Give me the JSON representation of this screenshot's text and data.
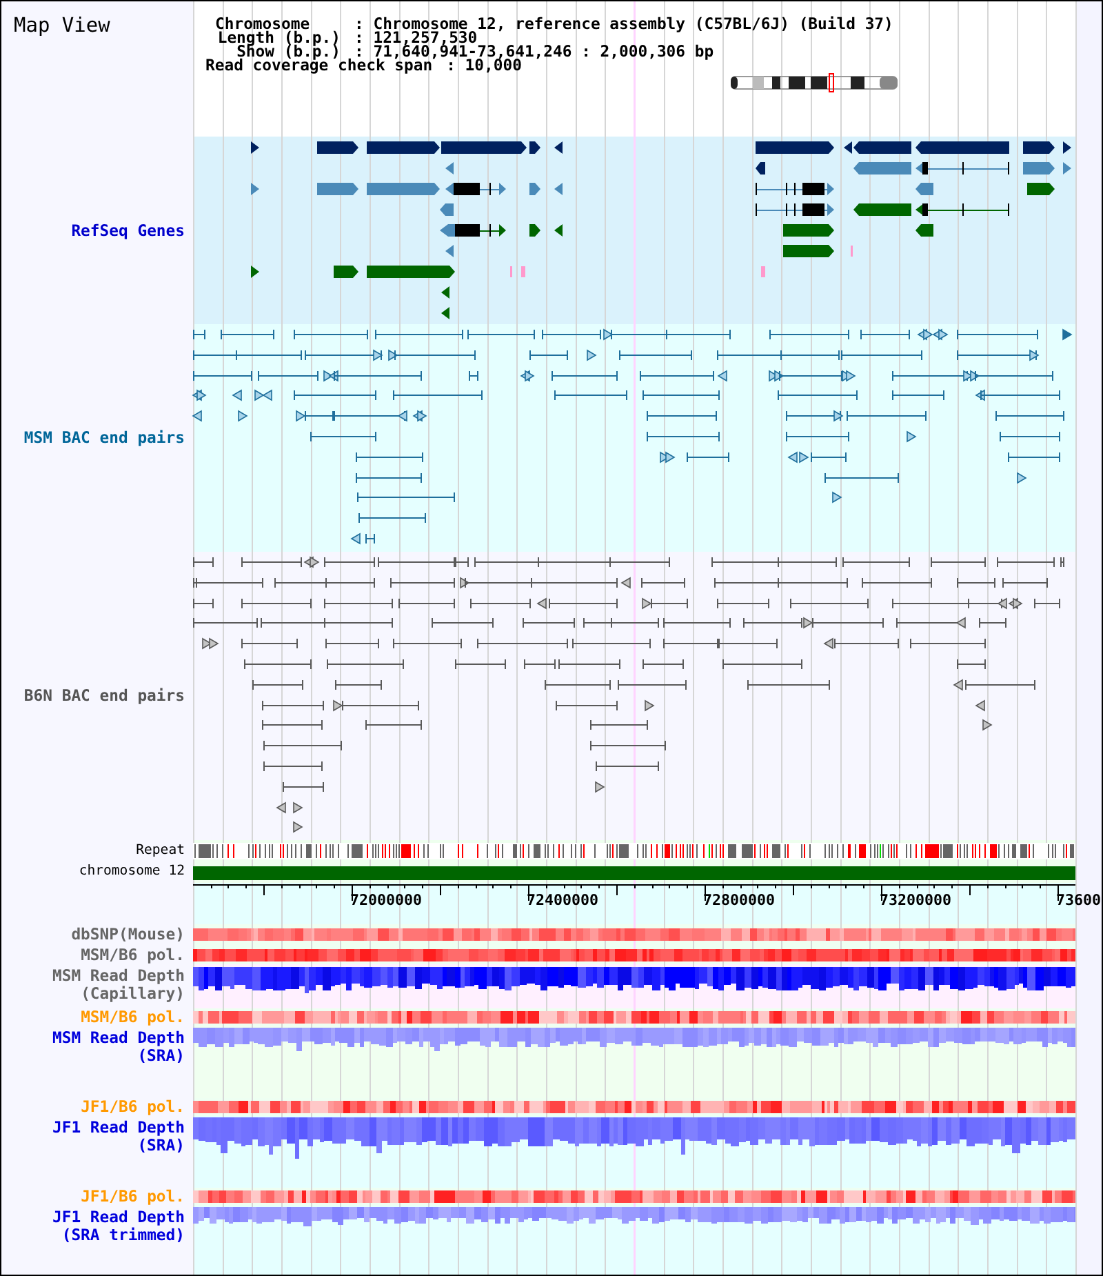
{
  "title": "Map View",
  "header": {
    "summary": [
      {
        "key": "Chromosome",
        "value": ": Chromosome 12, reference assembly (C57BL/6J) (Build 37)"
      },
      {
        "key": "Length (b.p.)",
        "value": ": 121,257,530"
      },
      {
        "key": "Show (b.p.)",
        "value": ": 71,640,941-73,641,246 : 2,000,306 bp"
      }
    ],
    "coverage": {
      "key": "Read coverage check span",
      "value": ": 10,000"
    }
  },
  "upper_tracks": [
    {
      "kind": "genes",
      "label": "RefSeq Genes",
      "color": "#0000cc"
    },
    {
      "kind": "bac_pairs",
      "label": "MSM BAC end pairs",
      "color": "#006699"
    },
    {
      "kind": "bac_pairs",
      "label": "B6N BAC end pairs",
      "color": "#555555"
    },
    {
      "kind": "repeat",
      "label": "Repeat",
      "color": "#000000"
    },
    {
      "kind": "chromosome",
      "label": "chromosome 12",
      "color": "#000000"
    }
  ],
  "ruler": {
    "ticks": [
      "72000000",
      "72400000",
      "72800000",
      "73200000",
      "73600"
    ]
  },
  "lower_tracks": [
    {
      "kind": "heatmap",
      "label": "dbSNP(Mouse)",
      "color": "#666666"
    },
    {
      "kind": "heatmap",
      "label": "MSM/B6 pol.",
      "color": "#666666"
    },
    {
      "kind": "depth",
      "label": "MSM Read Depth (Capillary)",
      "color": "#666666"
    },
    {
      "kind": "heatmap",
      "label": "MSM/B6 pol.",
      "color": "#ff9900"
    },
    {
      "kind": "depth",
      "label": "MSM Read Depth (SRA)",
      "color": "#0000dd"
    },
    {
      "kind": "heatmap",
      "label": "JF1/B6 pol.",
      "color": "#ff9900"
    },
    {
      "kind": "depth",
      "label": "JF1 Read Depth (SRA)",
      "color": "#0000dd"
    },
    {
      "kind": "heatmap",
      "label": "JF1/B6 pol.",
      "color": "#ff9900"
    },
    {
      "kind": "depth",
      "label": "JF1 Read Depth (SRA trimmed)",
      "color": "#0000dd"
    }
  ]
}
